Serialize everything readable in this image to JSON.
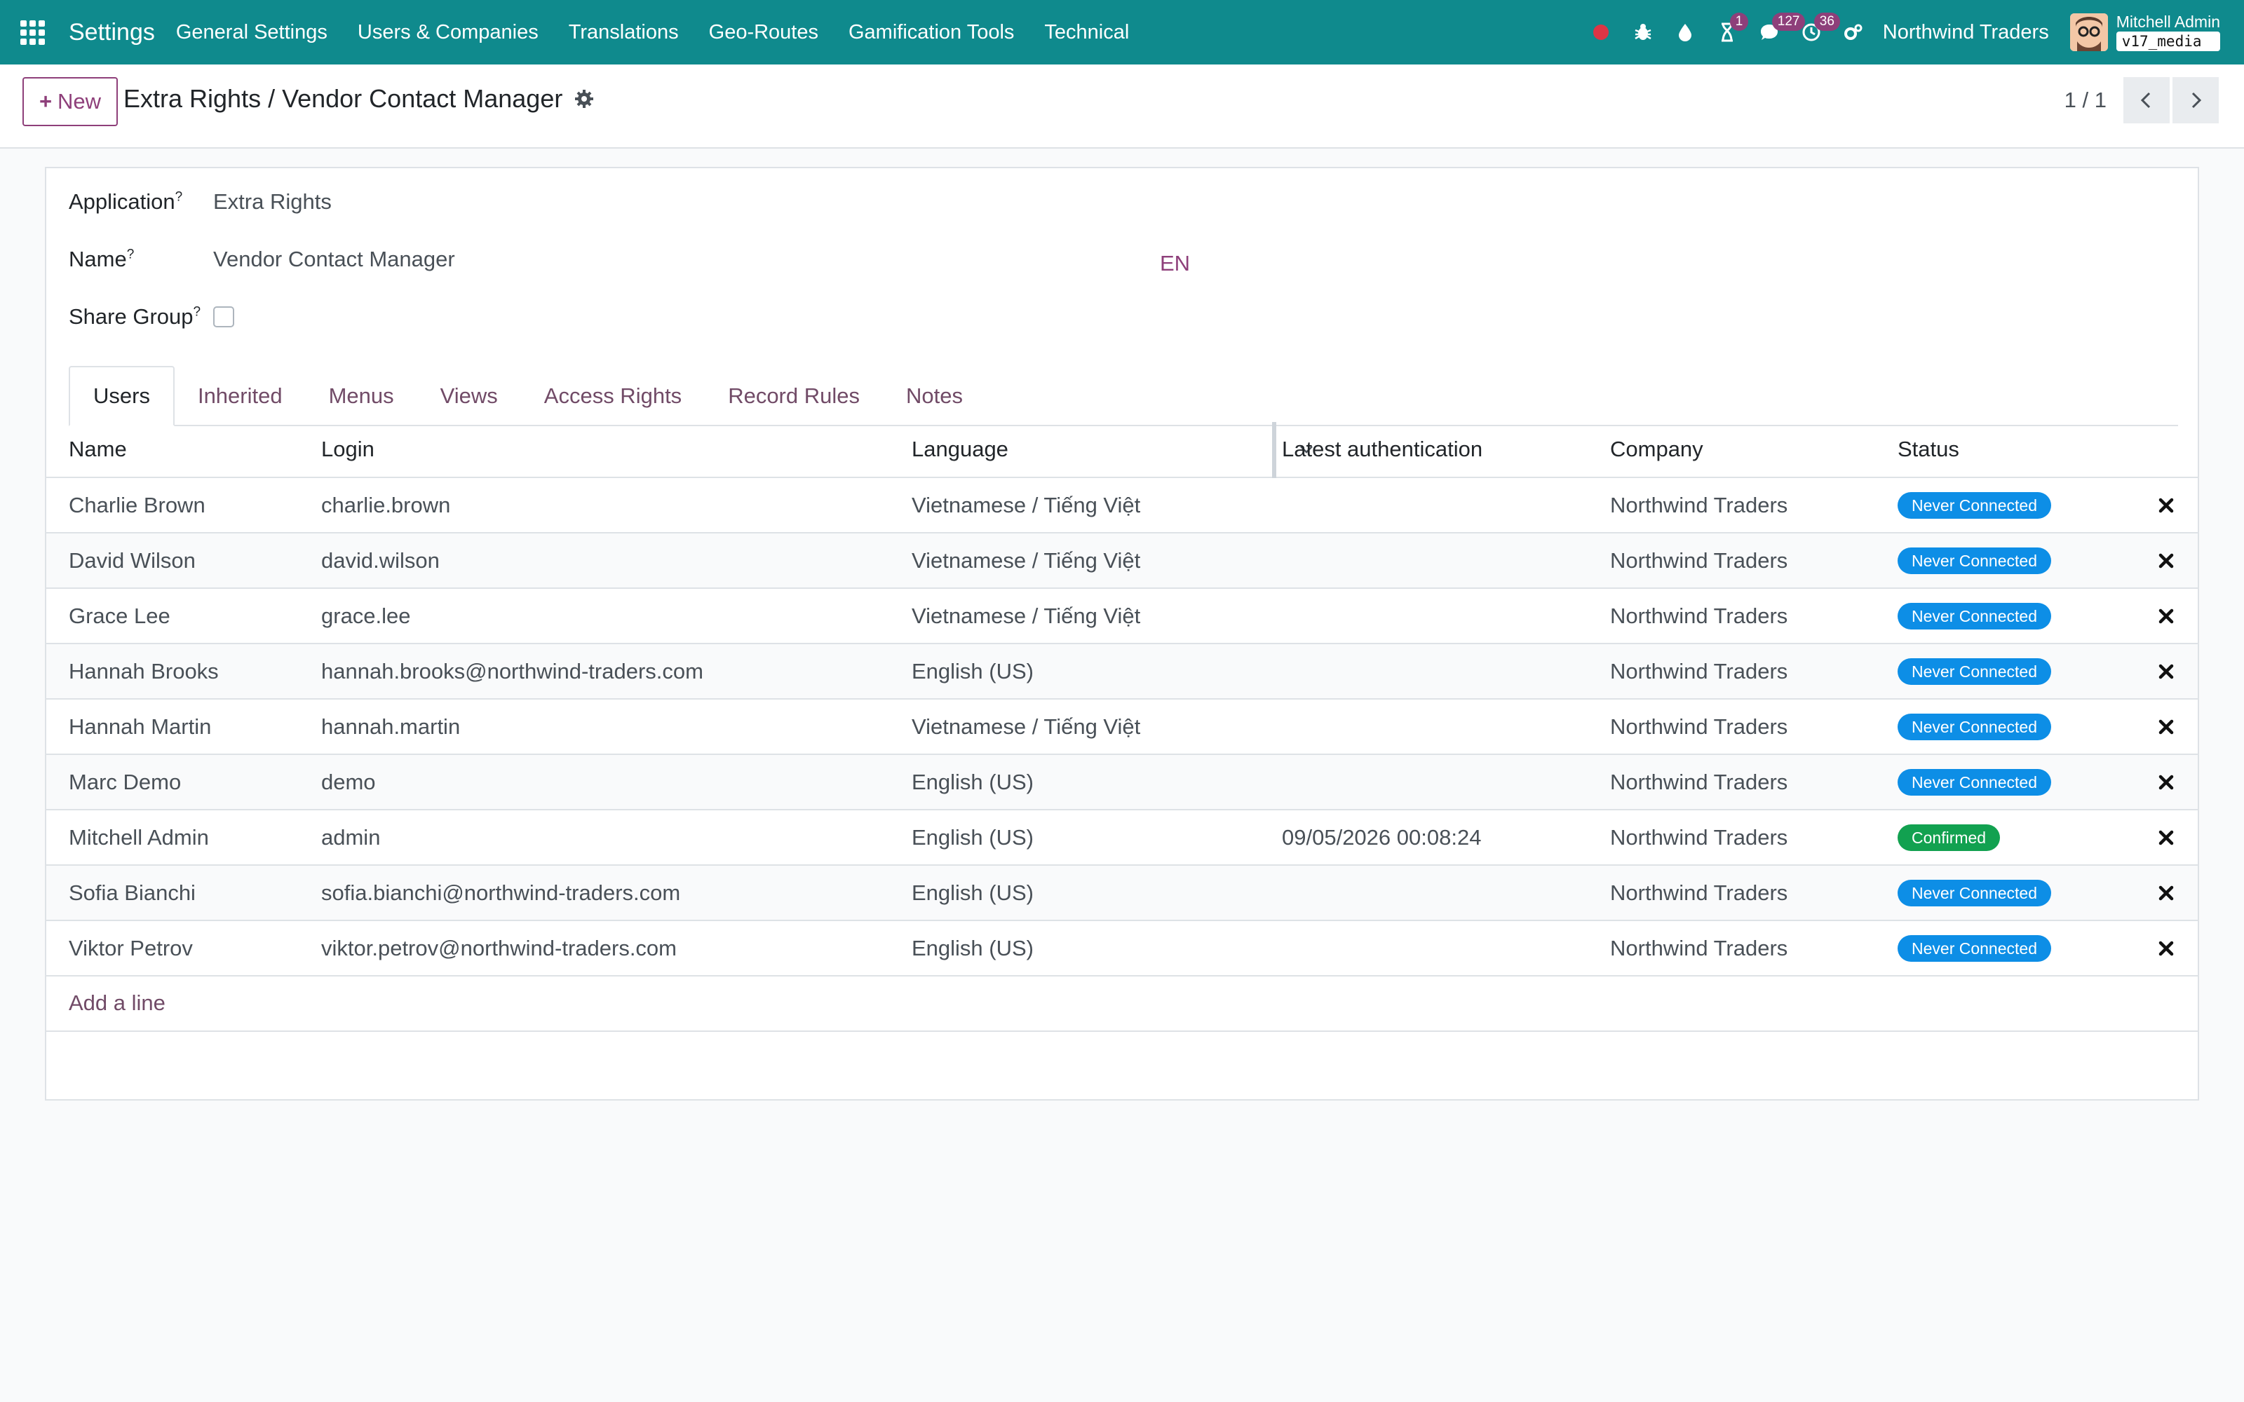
{
  "navbar": {
    "app_title": "Settings",
    "menu": [
      "General Settings",
      "Users & Companies",
      "Translations",
      "Geo-Routes",
      "Gamification Tools",
      "Technical"
    ],
    "activity_badge": "1",
    "messages_badge": "127",
    "updates_badge": "36",
    "company": "Northwind Traders",
    "user_name": "Mitchell Admin",
    "db_name": "v17_media"
  },
  "control_panel": {
    "new_label": "New",
    "breadcrumb": "Extra Rights / Vendor Contact Manager",
    "pager": "1 / 1"
  },
  "form": {
    "application_label": "Application",
    "application_value": "Extra Rights",
    "name_label": "Name",
    "name_value": "Vendor Contact Manager",
    "lang_tag": "EN",
    "share_label": "Share Group",
    "help_mark": "?"
  },
  "tabs": [
    "Users",
    "Inherited",
    "Menus",
    "Views",
    "Access Rights",
    "Record Rules",
    "Notes"
  ],
  "table": {
    "headers": {
      "name": "Name",
      "login": "Login",
      "language": "Language",
      "auth": "Latest authentication",
      "company": "Company",
      "status": "Status"
    },
    "rows": [
      {
        "name": "Charlie Brown",
        "login": "charlie.brown",
        "language": "Vietnamese / Tiếng Việt",
        "auth": "",
        "company": "Northwind Traders",
        "status": "Never Connected"
      },
      {
        "name": "David Wilson",
        "login": "david.wilson",
        "language": "Vietnamese / Tiếng Việt",
        "auth": "",
        "company": "Northwind Traders",
        "status": "Never Connected"
      },
      {
        "name": "Grace Lee",
        "login": "grace.lee",
        "language": "Vietnamese / Tiếng Việt",
        "auth": "",
        "company": "Northwind Traders",
        "status": "Never Connected"
      },
      {
        "name": "Hannah Brooks",
        "login": "hannah.brooks@northwind-traders.com",
        "language": "English (US)",
        "auth": "",
        "company": "Northwind Traders",
        "status": "Never Connected"
      },
      {
        "name": "Hannah Martin",
        "login": "hannah.martin",
        "language": "Vietnamese / Tiếng Việt",
        "auth": "",
        "company": "Northwind Traders",
        "status": "Never Connected"
      },
      {
        "name": "Marc Demo",
        "login": "demo",
        "language": "English (US)",
        "auth": "",
        "company": "Northwind Traders",
        "status": "Never Connected"
      },
      {
        "name": "Mitchell Admin",
        "login": "admin",
        "language": "English (US)",
        "auth": "09/05/2026 00:08:24",
        "company": "Northwind Traders",
        "status": "Confirmed"
      },
      {
        "name": "Sofia Bianchi",
        "login": "sofia.bianchi@northwind-traders.com",
        "language": "English (US)",
        "auth": "",
        "company": "Northwind Traders",
        "status": "Never Connected"
      },
      {
        "name": "Viktor Petrov",
        "login": "viktor.petrov@northwind-traders.com",
        "language": "English (US)",
        "auth": "",
        "company": "Northwind Traders",
        "status": "Never Connected"
      }
    ],
    "add_line": "Add a line"
  },
  "colors": {
    "navbar": "#0f8a8d",
    "accent": "#8e3f7a",
    "never_connected": "#0d8ee6",
    "confirmed": "#12a150"
  }
}
